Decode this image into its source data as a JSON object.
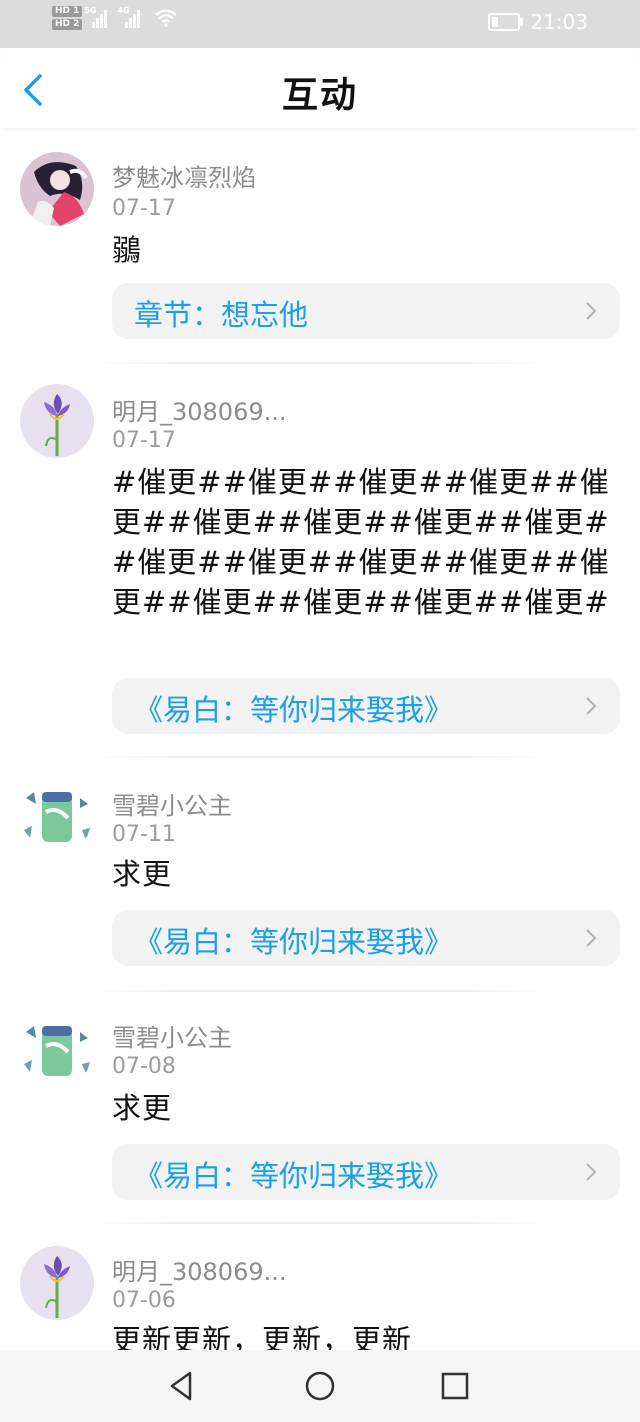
{
  "status_bar": {
    "hd1": "HD 1",
    "hd2": "HD 2",
    "signal1": "5G",
    "signal2": "4G",
    "time": "21:03"
  },
  "header": {
    "title": "互动"
  },
  "comments": [
    {
      "username": "梦魅冰凛烈焰",
      "date": "07-17",
      "content": "鶸",
      "link": "章节：想忘他",
      "avatar": "anime-girl-avatar"
    },
    {
      "username": "明月_308069...",
      "date": "07-17",
      "content": "#催更##催更##催更##催更##催更##催更##催更##催更##催更##催更##催更##催更##催更##催更##催更##催更##催更##催更#",
      "link": "《易白：等你归来娶我》",
      "avatar": "iris-flower-avatar"
    },
    {
      "username": "雪碧小公主",
      "date": "07-11",
      "content": "求更",
      "link": "《易白：等你归来娶我》",
      "avatar": "sprite-can-avatar"
    },
    {
      "username": "雪碧小公主",
      "date": "07-08",
      "content": "求更",
      "link": "《易白：等你归来娶我》",
      "avatar": "sprite-can-avatar"
    },
    {
      "username": "明月_308069...",
      "date": "07-06",
      "content": "更新更新，更新，更新",
      "avatar": "iris-flower-avatar"
    }
  ],
  "colors": {
    "link": "#1a9ef0",
    "back": "#1a9ef0",
    "status_bar": "#dcdcdc"
  }
}
